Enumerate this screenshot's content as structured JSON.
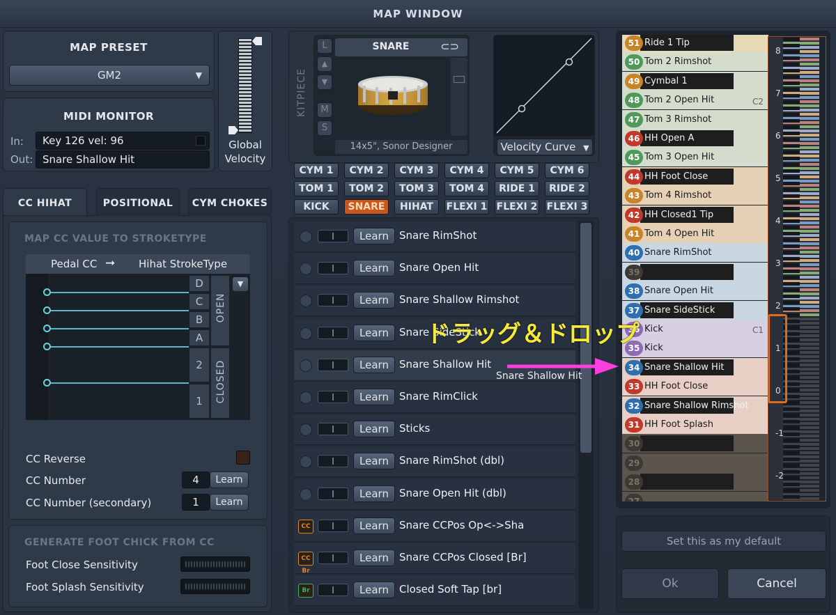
{
  "window_title": "MAP WINDOW",
  "map_preset": {
    "header": "MAP PRESET",
    "value": "GM2"
  },
  "midi_monitor": {
    "header": "MIDI MONITOR",
    "in_label": "In:",
    "in_value": "Key 126 vel: 96",
    "out_label": "Out:",
    "out_value": "Snare Shallow Hit"
  },
  "global_velocity": {
    "label_line1": "Global",
    "label_line2": "Velocity"
  },
  "tabs": [
    "CC HIHAT",
    "POSITIONAL",
    "CYM CHOKES"
  ],
  "cc_hihat": {
    "section_title": "MAP CC VALUE TO STROKETYPE",
    "mapping_left": "Pedal CC",
    "mapping_right": "Hihat StrokeType",
    "letters": [
      "D",
      "C",
      "B",
      "A",
      "2",
      "1"
    ],
    "open_label": "OPEN",
    "closed_label": "CLOSED",
    "cc_reverse_label": "CC Reverse",
    "cc_number_label": "CC Number",
    "cc_number_value": "4",
    "cc_number_secondary_label": "CC Number (secondary)",
    "cc_number_secondary_value": "1",
    "learn": "Learn"
  },
  "foot_chick": {
    "title": "GENERATE FOOT CHICK FROM CC",
    "close_label": "Foot Close Sensitivity",
    "splash_label": "Foot Splash Sensitivity"
  },
  "kitpiece": {
    "label": "KITPIECE",
    "side_buttons": [
      "L",
      "▲",
      "▼",
      "M",
      "S"
    ],
    "name": "SNARE",
    "caption": "14x5\", Sonor Designer",
    "velocity_curve": "Velocity Curve",
    "kit_buttons": [
      [
        "CYM 1",
        "CYM 2",
        "CYM 3",
        "CYM 4",
        "CYM 5",
        "CYM 6"
      ],
      [
        "TOM 1",
        "TOM 2",
        "TOM 3",
        "TOM 4",
        "RIDE 1",
        "RIDE 2"
      ],
      [
        "KICK",
        "SNARE",
        "HIHAT",
        "FLEXI 1",
        "FLEXI 2",
        "FLEXI 3"
      ]
    ],
    "selected": "SNARE"
  },
  "articulations": [
    {
      "name": "Snare RimShot",
      "icon": ""
    },
    {
      "name": "Snare Open Hit",
      "icon": ""
    },
    {
      "name": "Snare Shallow Rimshot",
      "icon": ""
    },
    {
      "name": "Snare SideStick",
      "icon": ""
    },
    {
      "name": "Snare Shallow Hit",
      "icon": ""
    },
    {
      "name": "Snare RimClick",
      "icon": ""
    },
    {
      "name": "Sticks",
      "icon": ""
    },
    {
      "name": "Snare RimShot (dbl)",
      "icon": ""
    },
    {
      "name": "Snare Open Hit (dbl)",
      "icon": ""
    },
    {
      "name": "Snare CCPos Op<->Sha",
      "icon": "CC"
    },
    {
      "name": "Snare CCPos Closed [Br]",
      "icon": "CC Br"
    },
    {
      "name": "Closed Soft Tap [br]",
      "icon": "Br"
    }
  ],
  "learn_label": "Learn",
  "overlay": {
    "drag_drop": "ドラッグ＆ドロップ",
    "dragged_item": "Snare Shallow Hit"
  },
  "keymap": [
    {
      "num": "51",
      "label": "Ride 1 Tip",
      "color": "#c9842a",
      "dark": true
    },
    {
      "num": "50",
      "label": "Tom 2 Rimshot",
      "color": "#4f9a5a",
      "dark": false
    },
    {
      "num": "49",
      "label": "Cymbal 1",
      "color": "#c9842a",
      "dark": true
    },
    {
      "num": "48",
      "label": "Tom 2 Open Hit",
      "color": "#4f9a5a",
      "dark": false
    },
    {
      "num": "47",
      "label": "Tom 3 Rimshot",
      "color": "#4f9a5a",
      "dark": false
    },
    {
      "num": "46",
      "label": "HH Open A",
      "color": "#c0392b",
      "dark": true
    },
    {
      "num": "45",
      "label": "Tom 3 Open Hit",
      "color": "#4f9a5a",
      "dark": false
    },
    {
      "num": "44",
      "label": "HH Foot Close",
      "color": "#c0392b",
      "dark": true
    },
    {
      "num": "43",
      "label": "Tom 4 Rimshot",
      "color": "#c9842a",
      "dark": false
    },
    {
      "num": "42",
      "label": "HH Closed1 Tip",
      "color": "#c0392b",
      "dark": true
    },
    {
      "num": "41",
      "label": "Tom 4 Open Hit",
      "color": "#c9842a",
      "dark": false
    },
    {
      "num": "40",
      "label": "Snare RimShot",
      "color": "#2f6fb0",
      "dark": false
    },
    {
      "num": "39",
      "label": "",
      "color": "#3a3a3a",
      "dark": true
    },
    {
      "num": "38",
      "label": "Snare Open Hit",
      "color": "#2f6fb0",
      "dark": false
    },
    {
      "num": "37",
      "label": "Snare SideStick",
      "color": "#2f6fb0",
      "dark": true
    },
    {
      "num": "36",
      "label": "Kick",
      "color": "#8e6bb3",
      "dark": false
    },
    {
      "num": "35",
      "label": "Kick",
      "color": "#8e6bb3",
      "dark": false
    },
    {
      "num": "34",
      "label": "Snare Shallow Hit",
      "color": "#2f6fb0",
      "dark": true
    },
    {
      "num": "33",
      "label": "HH Foot Close",
      "color": "#c0392b",
      "dark": false
    },
    {
      "num": "32",
      "label": "Snare Shallow Rimshot",
      "color": "#2f6fb0",
      "dark": true
    },
    {
      "num": "31",
      "label": "HH Foot Splash",
      "color": "#c0392b",
      "dark": false
    },
    {
      "num": "30",
      "label": "",
      "color": "#3a3a3a",
      "dark": true
    },
    {
      "num": "29",
      "label": "",
      "color": "#3a3a3a",
      "dark": false
    },
    {
      "num": "28",
      "label": "",
      "color": "#3a3a3a",
      "dark": true
    },
    {
      "num": "27",
      "label": "",
      "color": "#3a3a3a",
      "dark": false
    }
  ],
  "key_backgrounds": {
    "light_default": "#d8d2c2",
    "green": "#cbd7c2",
    "peach": "#e4cbb0",
    "blue": "#c4d2de",
    "purple": "#cdc4d8",
    "salmon": "#e4c7bd",
    "empty": "#5b554d"
  },
  "octave_markers": [
    "8",
    "7",
    "6",
    "5",
    "4",
    "3",
    "2",
    "1",
    "0",
    "-1",
    "-2"
  ],
  "key_markers": {
    "c2": "C2",
    "c1": "C1"
  },
  "buttons": {
    "set_default": "Set this as my default",
    "ok": "Ok",
    "cancel": "Cancel"
  }
}
